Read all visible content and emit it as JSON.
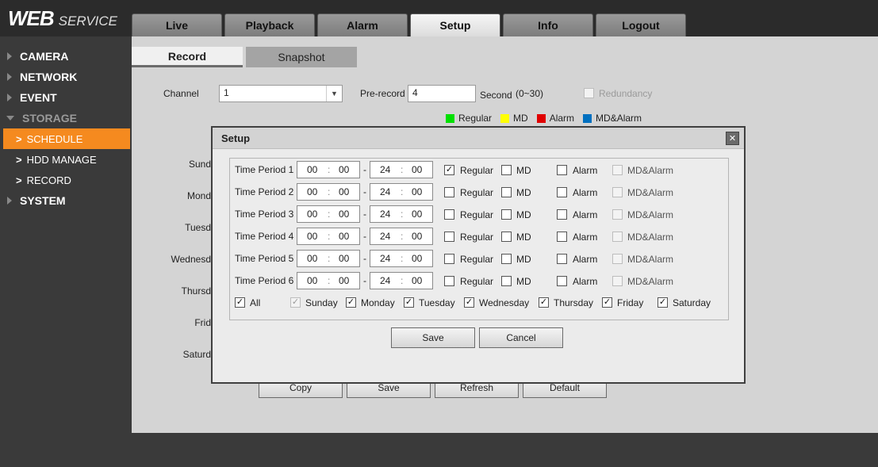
{
  "header": {
    "logo_main": "WEB",
    "logo_sub": "SERVICE",
    "tabs": [
      {
        "label": "Live"
      },
      {
        "label": "Playback"
      },
      {
        "label": "Alarm"
      },
      {
        "label": "Setup"
      },
      {
        "label": "Info"
      },
      {
        "label": "Logout"
      }
    ],
    "active_tab": "Setup"
  },
  "sidebar": {
    "items": [
      {
        "label": "CAMERA"
      },
      {
        "label": "NETWORK"
      },
      {
        "label": "EVENT"
      },
      {
        "label": "STORAGE"
      },
      {
        "label": "SYSTEM"
      }
    ],
    "storage_sub": [
      {
        "label": "SCHEDULE"
      },
      {
        "label": "HDD MANAGE"
      },
      {
        "label": "RECORD"
      }
    ]
  },
  "main": {
    "subtabs": [
      {
        "label": "Record"
      },
      {
        "label": "Snapshot"
      }
    ],
    "channel_label": "Channel",
    "channel_value": "1",
    "prerecord_label": "Pre-record",
    "prerecord_value": "4",
    "second_label": "Second",
    "range_label": "(0~30)",
    "redundancy_label": "Redundancy",
    "legend": [
      {
        "label": "Regular",
        "color": "#00e000"
      },
      {
        "label": "MD",
        "color": "#ffff00"
      },
      {
        "label": "Alarm",
        "color": "#e00000"
      },
      {
        "label": "MD&Alarm",
        "color": "#0070c0"
      }
    ],
    "days": [
      "Sund",
      "Mond",
      "Tuesd",
      "Wednesd",
      "Thursd",
      "Frid",
      "Saturd"
    ],
    "buttons": {
      "copy": "Copy",
      "save": "Save",
      "refresh": "Refresh",
      "default": "Default"
    }
  },
  "modal": {
    "title": "Setup",
    "close_icon": "close-icon",
    "periods": [
      {
        "label": "Time Period 1",
        "sh": "00",
        "sm": "00",
        "eh": "24",
        "em": "00",
        "regular": true
      },
      {
        "label": "Time Period 2",
        "sh": "00",
        "sm": "00",
        "eh": "24",
        "em": "00",
        "regular": false
      },
      {
        "label": "Time Period 3",
        "sh": "00",
        "sm": "00",
        "eh": "24",
        "em": "00",
        "regular": false
      },
      {
        "label": "Time Period 4",
        "sh": "00",
        "sm": "00",
        "eh": "24",
        "em": "00",
        "regular": false
      },
      {
        "label": "Time Period 5",
        "sh": "00",
        "sm": "00",
        "eh": "24",
        "em": "00",
        "regular": false
      },
      {
        "label": "Time Period 6",
        "sh": "00",
        "sm": "00",
        "eh": "24",
        "em": "00",
        "regular": false
      }
    ],
    "type_labels": {
      "regular": "Regular",
      "md": "MD",
      "alarm": "Alarm",
      "mdalarm": "MD&Alarm"
    },
    "all_label": "All",
    "weekdays": [
      "Sunday",
      "Monday",
      "Tuesday",
      "Wednesday",
      "Thursday",
      "Friday",
      "Saturday"
    ],
    "save": "Save",
    "cancel": "Cancel"
  }
}
